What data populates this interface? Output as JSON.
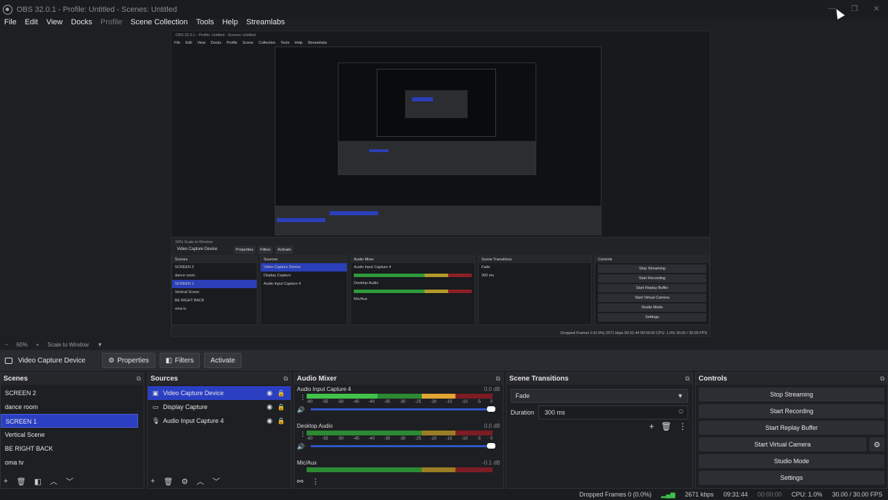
{
  "window": {
    "title": "OBS 32.0.1 - Profile: Untitled - Scenes: Untitled",
    "controls": [
      "—",
      "❐",
      "✕"
    ]
  },
  "menu": [
    "File",
    "Edit",
    "View",
    "Docks",
    "Profile",
    "Scene Collection",
    "Tools",
    "Help",
    "Streamlabs"
  ],
  "nested_preview": {
    "title": "OBS 32.0.1 - Profile: Untitled - Scenes: Untitled",
    "menu": "File Edit View Docks Profile Scene Collection Tools Help Streamlabs",
    "scale": "60%   Scale to Window",
    "source": "Video Capture Device",
    "buttons": [
      "Properties",
      "Filters",
      "Activate"
    ],
    "scenes_header": "Scenes",
    "scenes": [
      "SCREEN 2",
      "dance room",
      "SCREEN 1",
      "Vertical Scene",
      "BE RIGHT BACK",
      "oma tv"
    ],
    "sources_header": "Sources",
    "sources": [
      "Video Capture Device",
      "Display Capture",
      "Audio Input Capture 4"
    ],
    "mixer_header": "Audio Mixer",
    "mixer_channels": [
      "Audio Input Capture 4",
      "Desktop Audio",
      "Mic/Aux"
    ],
    "transitions_header": "Scene Transitions",
    "transition": "Fade",
    "duration": "300 ms",
    "controls_header": "Controls",
    "controls": [
      "Stop Streaming",
      "Start Recording",
      "Start Replay Buffer",
      "Start Virtual Camera",
      "Studio Mode",
      "Settings"
    ],
    "status": "Dropped Frames 0 (0.0%)   2671 kbps   09:31:44   00:00:00   CPU: 1.0%   30.00 / 30.00 FPS"
  },
  "scale_bar": {
    "minus": "−",
    "zoom": "60%",
    "plus": "+",
    "mode": "Scale to Window"
  },
  "source_toolbar": {
    "source_name": "Video Capture Device",
    "properties": "Properties",
    "filters": "Filters",
    "activate": "Activate"
  },
  "scenes": {
    "title": "Scenes",
    "items": [
      "SCREEN 2",
      "dance room",
      "SCREEN 1",
      "Vertical Scene",
      "BE RIGHT BACK",
      "oma tv"
    ],
    "selected": "SCREEN 1"
  },
  "sources": {
    "title": "Sources",
    "items": [
      {
        "label": "Video Capture Device",
        "icon": "camera-icon"
      },
      {
        "label": "Display Capture",
        "icon": "monitor-icon"
      },
      {
        "label": "Audio Input Capture 4",
        "icon": "mic-icon"
      }
    ],
    "selected": "Video Capture Device"
  },
  "audio_mixer": {
    "title": "Audio Mixer",
    "channels": [
      {
        "name": "Audio Input Capture 4",
        "db": "0.0 dB"
      },
      {
        "name": "Desktop Audio",
        "db": "0.0 dB"
      },
      {
        "name": "Mic/Aux",
        "db": "-0.1 dB"
      }
    ],
    "ticks": [
      "-60",
      "-55",
      "-50",
      "-45",
      "-40",
      "-35",
      "-30",
      "-25",
      "-20",
      "-15",
      "-10",
      "-5",
      "0"
    ]
  },
  "scene_transitions": {
    "title": "Scene Transitions",
    "transition": "Fade",
    "duration_label": "Duration",
    "duration_value": "300 ms"
  },
  "controls": {
    "title": "Controls",
    "stop_streaming": "Stop Streaming",
    "start_recording": "Start Recording",
    "start_replay_buffer": "Start Replay Buffer",
    "start_virtual_camera": "Start Virtual Camera",
    "studio_mode": "Studio Mode",
    "settings": "Settings"
  },
  "status": {
    "dropped_frames": "Dropped Frames 0 (0.0%)",
    "bitrate": "2671 kbps",
    "stream_time": "09:31:44",
    "record_time": "00:00:00",
    "cpu": "CPU: 1.0%",
    "fps": "30.00 / 30.00 FPS"
  }
}
